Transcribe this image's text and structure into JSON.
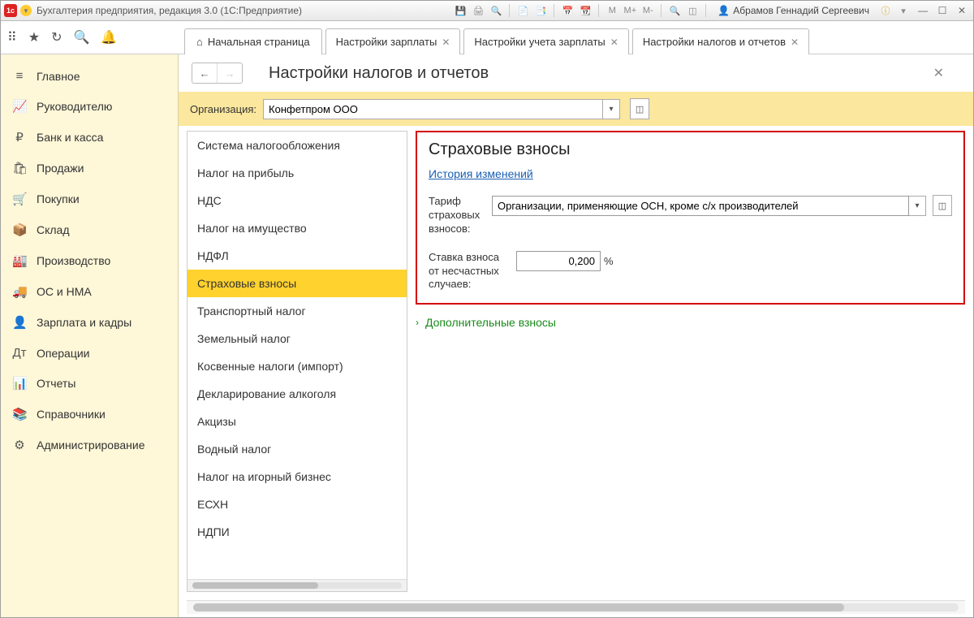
{
  "titlebar": {
    "app_title": "Бухгалтерия предприятия, редакция 3.0  (1С:Предприятие)",
    "user_name": "Абрамов Геннадий Сергеевич",
    "m_labels": [
      "M",
      "M+",
      "M-"
    ]
  },
  "tabs": {
    "home": "Начальная страница",
    "t1": "Настройки зарплаты",
    "t2": "Настройки учета зарплаты",
    "t3": "Настройки налогов и отчетов"
  },
  "sidebar": {
    "items": [
      {
        "icon": "≡",
        "label": "Главное"
      },
      {
        "icon": "📈",
        "label": "Руководителю"
      },
      {
        "icon": "₽",
        "label": "Банк и касса"
      },
      {
        "icon": "🛍",
        "label": "Продажи"
      },
      {
        "icon": "🛒",
        "label": "Покупки"
      },
      {
        "icon": "📦",
        "label": "Склад"
      },
      {
        "icon": "🏭",
        "label": "Производство"
      },
      {
        "icon": "🚚",
        "label": "ОС и НМА"
      },
      {
        "icon": "👤",
        "label": "Зарплата и кадры"
      },
      {
        "icon": "Дт",
        "label": "Операции"
      },
      {
        "icon": "📊",
        "label": "Отчеты"
      },
      {
        "icon": "📚",
        "label": "Справочники"
      },
      {
        "icon": "⚙",
        "label": "Администрирование"
      }
    ]
  },
  "page": {
    "title": "Настройки налогов и отчетов",
    "org_label": "Организация:",
    "org_value": "Конфетпром ООО"
  },
  "categories": [
    "Система налогообложения",
    "Налог на прибыль",
    "НДС",
    "Налог на имущество",
    "НДФЛ",
    "Страховые взносы",
    "Транспортный налог",
    "Земельный налог",
    "Косвенные налоги (импорт)",
    "Декларирование алкоголя",
    "Акцизы",
    "Водный налог",
    "Налог на игорный бизнес",
    "ЕСХН",
    "НДПИ"
  ],
  "selected_category_index": 5,
  "detail": {
    "section_title": "Страховые взносы",
    "history_link": "История изменений",
    "tariff_label": "Тариф страховых взносов:",
    "tariff_value": "Организации, применяющие ОСН, кроме с/х производителей",
    "rate_label": "Ставка взноса от несчастных случаев:",
    "rate_value": "0,200",
    "rate_unit": "%",
    "additional": "Дополнительные взносы"
  }
}
